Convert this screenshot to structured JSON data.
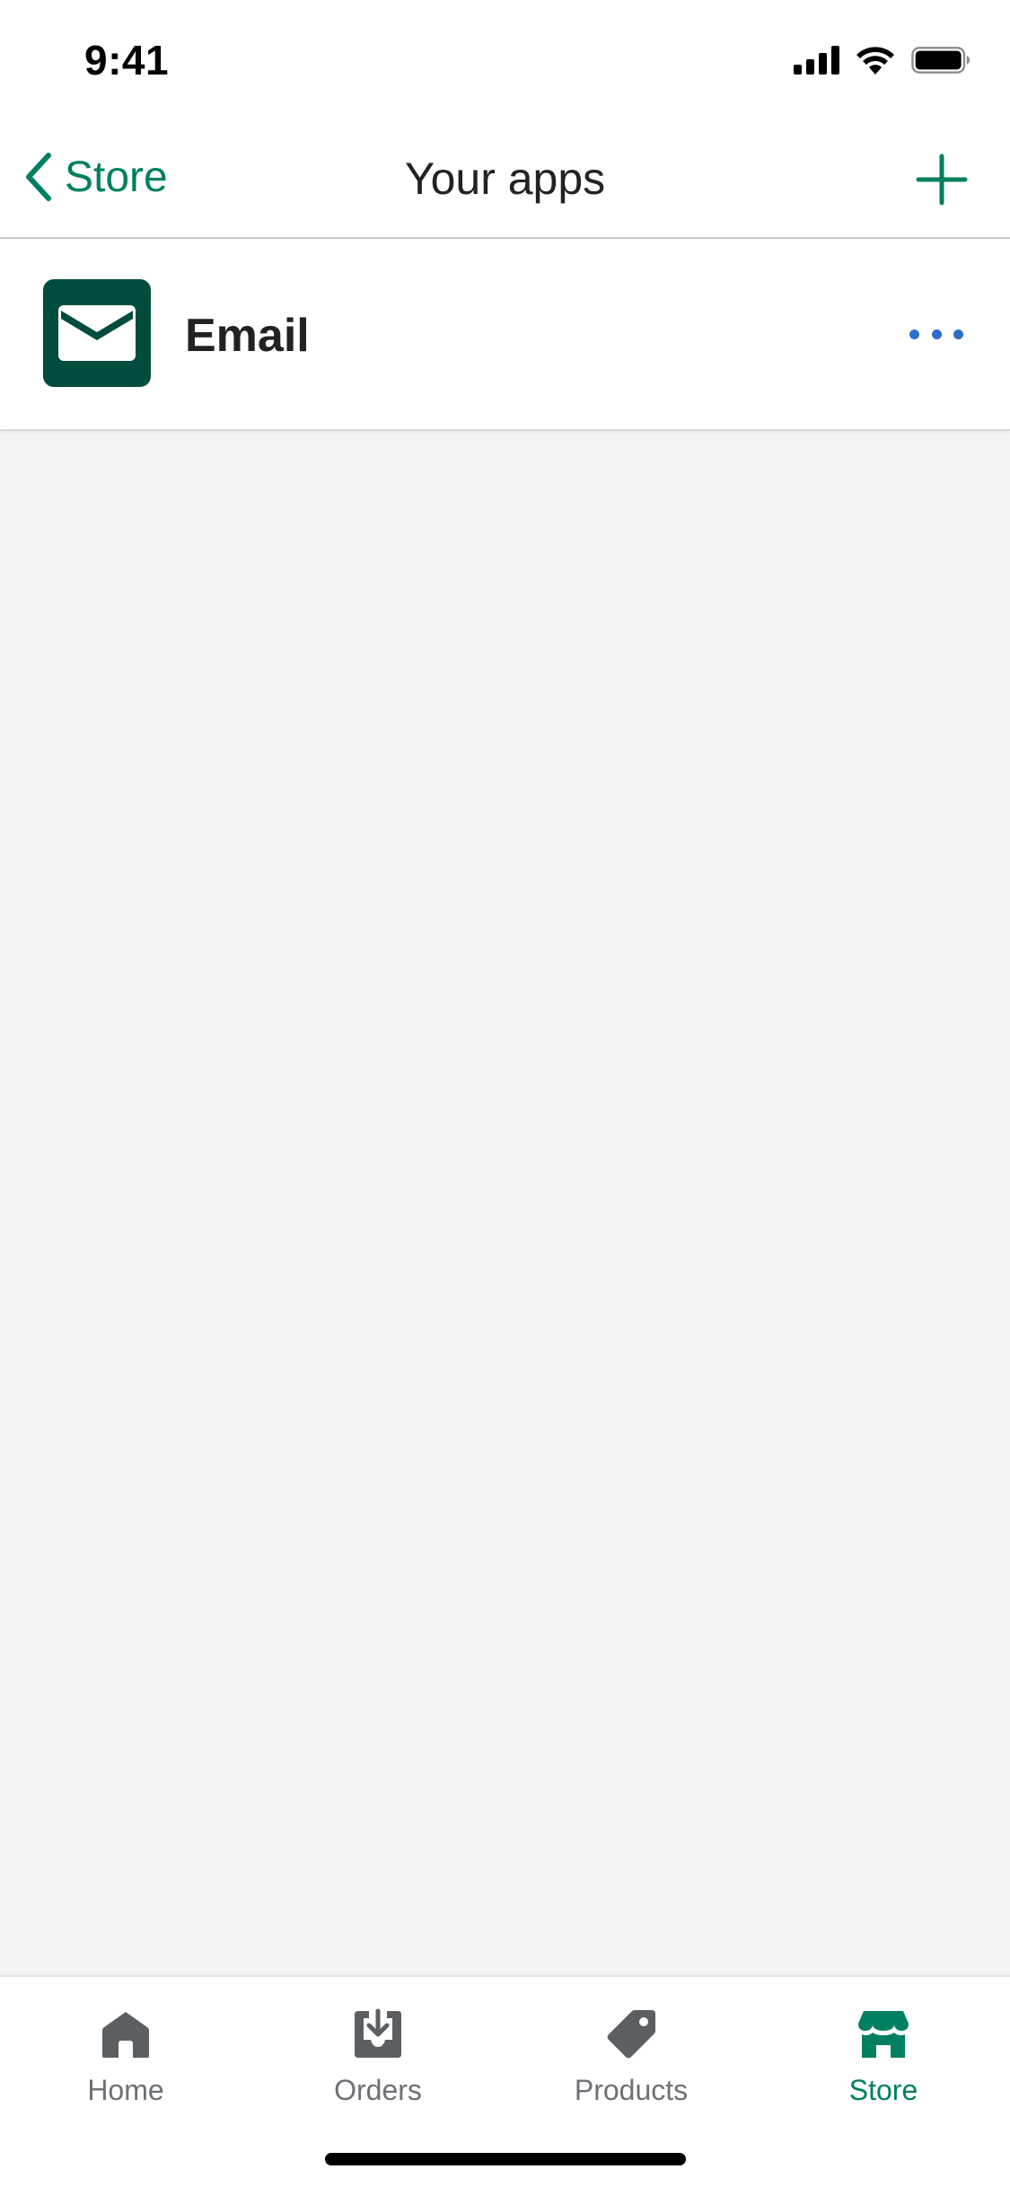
{
  "status_bar": {
    "time": "9:41",
    "icons": [
      "cellular-signal-icon",
      "wifi-icon",
      "battery-icon"
    ]
  },
  "nav": {
    "back_label": "Store",
    "title": "Your apps",
    "icons": {
      "back": "chevron-left-icon",
      "add": "plus-icon"
    }
  },
  "apps": [
    {
      "name": "Email",
      "icon": "envelope-icon"
    }
  ],
  "tabs": [
    {
      "label": "Home",
      "icon": "home-icon",
      "active": false
    },
    {
      "label": "Orders",
      "icon": "orders-icon",
      "active": false
    },
    {
      "label": "Products",
      "icon": "tag-icon",
      "active": false
    },
    {
      "label": "Store",
      "icon": "store-icon",
      "active": true
    }
  ],
  "colors": {
    "accent": "#008060",
    "app_icon_bg": "#004c3f",
    "more_dots": "#2c6ecb",
    "tab_inactive": "#6d7175",
    "background": "#f4f4f4"
  }
}
